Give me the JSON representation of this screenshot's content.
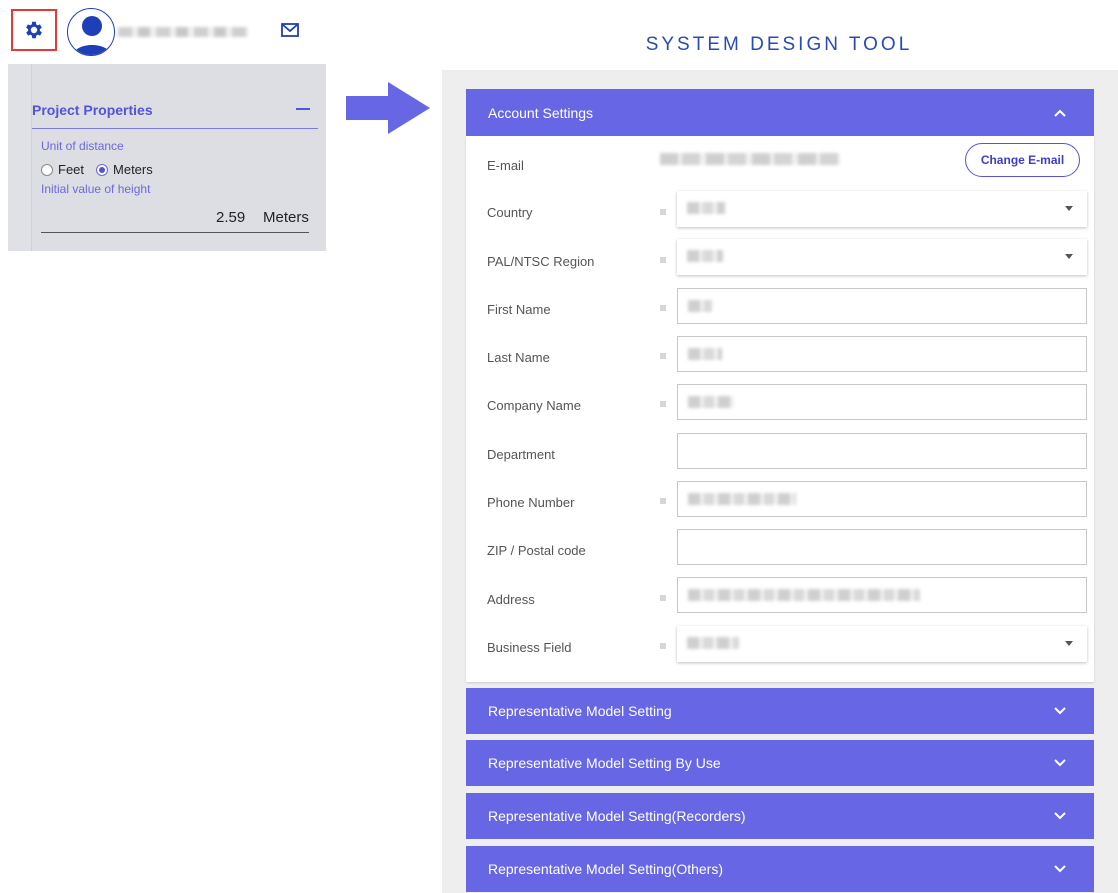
{
  "header": {
    "settings_icon": "gear-icon",
    "avatar_icon": "user-avatar-icon",
    "mail_icon": "mail-icon",
    "title": "SYSTEM DESIGN TOOL"
  },
  "project_properties": {
    "title": "Project Properties",
    "unit_label": "Unit of distance",
    "options": [
      "Feet",
      "Meters"
    ],
    "selected": "Meters",
    "height_label": "Initial value of height",
    "height_value": "2.59",
    "height_unit": "Meters"
  },
  "account_settings": {
    "title": "Account Settings",
    "change_email_label": "Change E-mail",
    "fields": [
      {
        "label": "E-mail"
      },
      {
        "label": "Country"
      },
      {
        "label": "PAL/NTSC Region"
      },
      {
        "label": "First Name"
      },
      {
        "label": "Last Name"
      },
      {
        "label": "Company Name"
      },
      {
        "label": "Department"
      },
      {
        "label": "Phone Number"
      },
      {
        "label": "ZIP / Postal code"
      },
      {
        "label": "Address"
      },
      {
        "label": "Business Field"
      }
    ]
  },
  "sections": [
    {
      "title": "Representative Model Setting"
    },
    {
      "title": "Representative Model Setting By Use"
    },
    {
      "title": "Representative Model Setting(Recorders)"
    },
    {
      "title": "Representative Model Setting(Others)"
    }
  ],
  "colors": {
    "accent": "#6767e6",
    "title": "#2b4bb0",
    "highlight_box": "#e53935"
  }
}
